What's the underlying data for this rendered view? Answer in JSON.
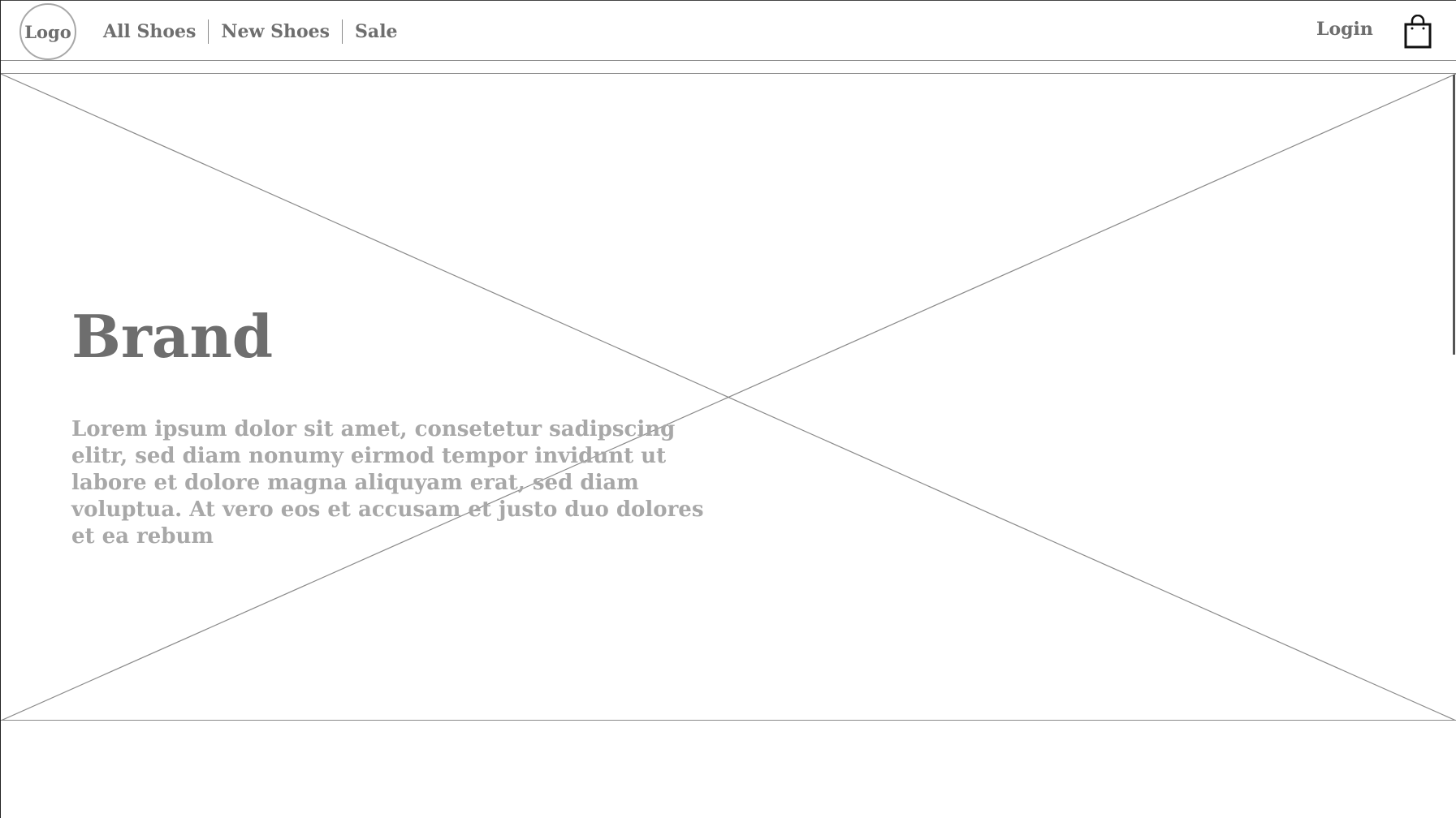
{
  "header": {
    "logo_label": "Logo",
    "nav": [
      {
        "label": "All Shoes"
      },
      {
        "label": "New Shoes"
      },
      {
        "label": "Sale"
      }
    ],
    "login_label": "Login",
    "cart_icon": "shopping-bag-icon"
  },
  "hero": {
    "placeholder_icon": "image-placeholder-icon",
    "title": "Brand",
    "text": "Lorem ipsum dolor sit amet, consetetur sadipscing elitr, sed diam nonumy eirmod tempor invidunt ut labore et dolore magna aliquyam erat, sed diam voluptua. At vero eos et accusam et justo duo dolores et ea rebum"
  },
  "colors": {
    "text_dark": "#6e6e6e",
    "text_light": "#a8a8a8",
    "lines": "#8a8a8a",
    "background": "#ffffff"
  }
}
